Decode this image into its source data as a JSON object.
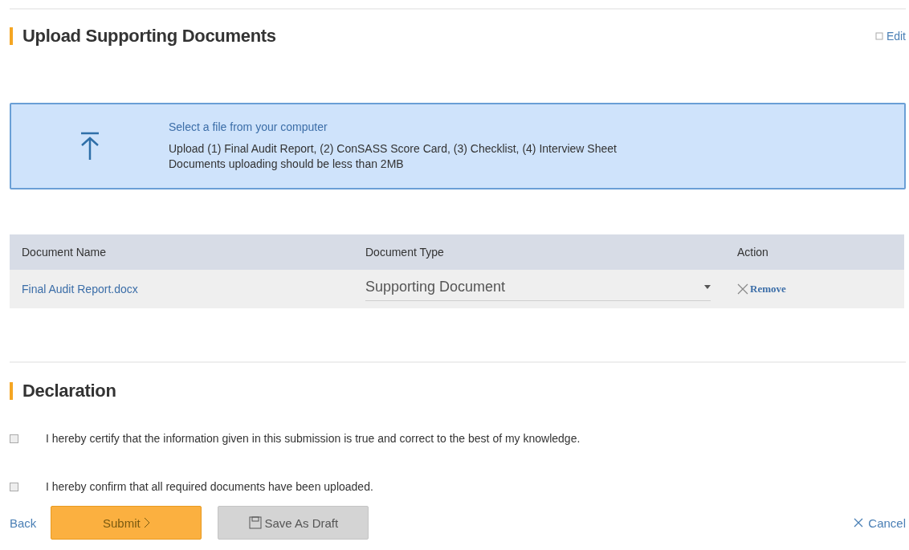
{
  "upload_section": {
    "title": "Upload Supporting Documents",
    "edit_link": "Edit"
  },
  "upload_box": {
    "prompt": "Select a file from your computer",
    "instructions": "Upload (1) Final Audit Report, (2) ConSASS Score Card, (3) Checklist, (4) Interview Sheet",
    "limit": "Documents uploading should be less than 2MB"
  },
  "table": {
    "columns": [
      "Document Name",
      "Document Type",
      "Action"
    ],
    "rows": [
      {
        "name": "Final Audit Report.docx",
        "type": "Supporting Document",
        "action": "Remove"
      }
    ]
  },
  "declaration": {
    "title": "Declaration",
    "items": [
      {
        "label": "I hereby certify that the information given in this submission is true and correct to the best of my knowledge.",
        "checked": false
      },
      {
        "label": "I hereby confirm that all required documents have been uploaded.",
        "checked": false
      }
    ]
  },
  "footer": {
    "back": "Back",
    "submit": "Submit",
    "save_draft": "Save As Draft",
    "cancel": "Cancel"
  }
}
